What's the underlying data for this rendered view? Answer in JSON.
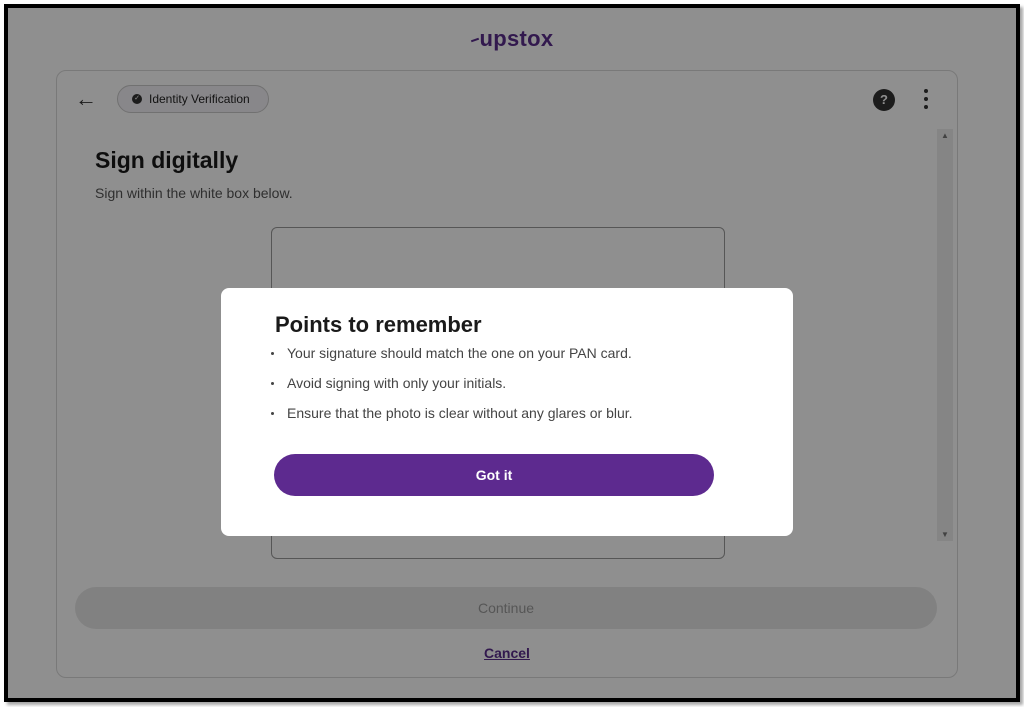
{
  "brand": {
    "logo_text": "upstox",
    "color": "#5a2d8c"
  },
  "header": {
    "step_chip": {
      "label": "Identity Verification",
      "icon": "check-circle-icon"
    },
    "help_icon": "?",
    "menu_icon": "kebab-menu-icon"
  },
  "main": {
    "title": "Sign digitally",
    "subtitle": "Sign within the white box below."
  },
  "footer": {
    "continue_label": "Continue",
    "cancel_label": "Cancel"
  },
  "modal": {
    "title": "Points to remember",
    "points": [
      "Your signature should match the one on your PAN card.",
      "Avoid signing with only your initials.",
      "Ensure that the photo is clear without any glares or blur."
    ],
    "button_label": "Got it",
    "button_color": "#5d2a8f"
  }
}
